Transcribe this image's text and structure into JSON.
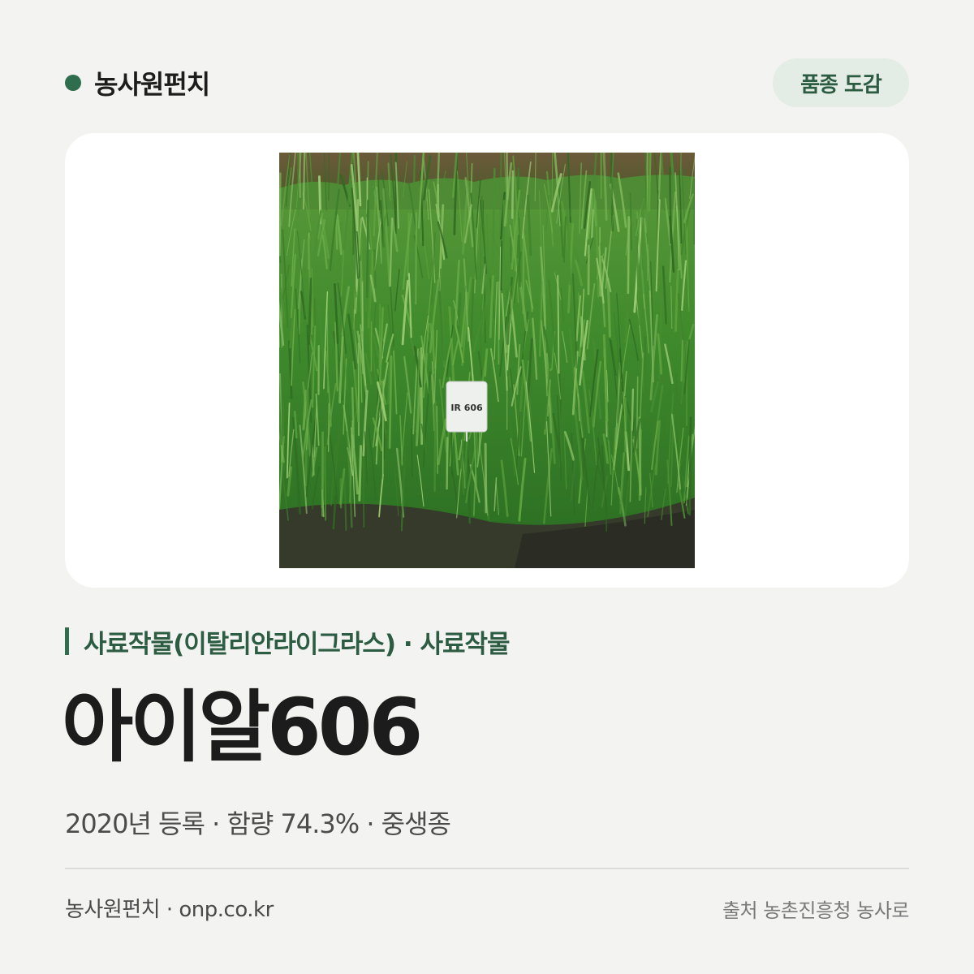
{
  "header": {
    "brand": "농사원펀치",
    "catalog_label": "품종 도감"
  },
  "photo": {
    "sign_text": "IR 606"
  },
  "variety": {
    "category": "사료작물(이탈리안라이그라스) · 사료작물",
    "name": "아이알606",
    "meta": "2020년 등록 · 함량 74.3% · 중생종"
  },
  "footer": {
    "site": "농사원펀치 · onp.co.kr",
    "source": "출처 농촌진흥청 농사로"
  },
  "colors": {
    "accent": "#2e6e4e",
    "background": "#f3f3f1",
    "pill_background": "#e3ece5"
  }
}
